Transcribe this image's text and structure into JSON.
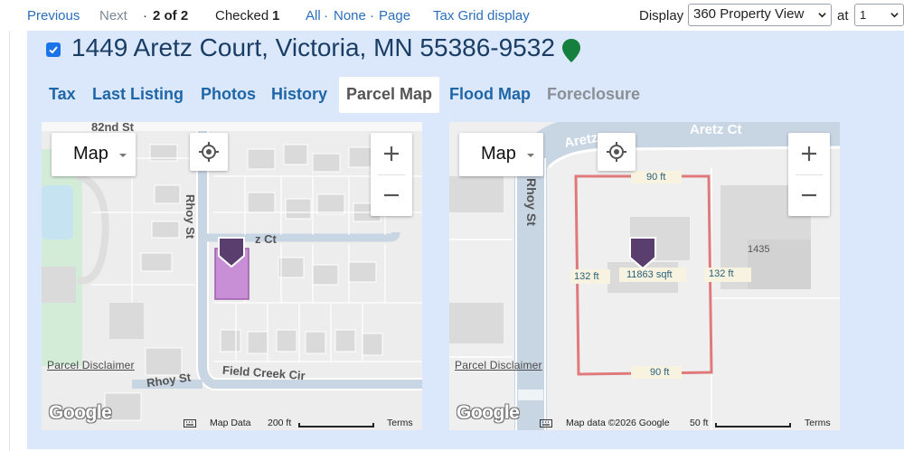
{
  "nav": {
    "previous": "Previous",
    "next": "Next",
    "dot": "·",
    "position": "2 of 2",
    "checked_label": "Checked",
    "checked_count": "1",
    "all": "All",
    "none": "None",
    "page": "Page",
    "sep": "·",
    "tax_grid": "Tax Grid display",
    "display_label": "Display",
    "display_value": "360 Property View",
    "at_label": "at",
    "at_value": "1"
  },
  "property": {
    "address": "1449 Aretz Court, Victoria, MN 55386-9532",
    "checked": true,
    "pin_color": "#15803d"
  },
  "tabs": [
    {
      "label": "Tax",
      "state": "normal"
    },
    {
      "label": "Last Listing",
      "state": "normal"
    },
    {
      "label": "Photos",
      "state": "normal"
    },
    {
      "label": "History",
      "state": "normal"
    },
    {
      "label": "Parcel Map",
      "state": "active"
    },
    {
      "label": "Flood Map",
      "state": "normal"
    },
    {
      "label": "Foreclosure",
      "state": "disabled"
    }
  ],
  "map_left": {
    "type_label": "Map",
    "zoom_in": "+",
    "zoom_out": "−",
    "disclaimer": "Parcel Disclaimer",
    "google": "Google",
    "map_data": "Map Data",
    "scale": "200 ft",
    "terms": "Terms",
    "streets": {
      "s82nd": "82nd St",
      "rhoy": "Rhoy St",
      "aretz_partial": "z Ct",
      "rhoy_st": "Rhoy St",
      "field_creek": "Field Creek Cir"
    },
    "parcel_color": "#c98fd6"
  },
  "map_right": {
    "type_label": "Map",
    "zoom_in": "+",
    "zoom_out": "−",
    "disclaimer": "Parcel Disclaimer",
    "google": "Google",
    "map_data": "Map data ©2026 Google",
    "scale": "50 ft",
    "terms": "Terms",
    "streets": {
      "aretz_partial": "Aretz",
      "aretz_ct": "Aretz Ct",
      "rhoy": "Rhoy St"
    },
    "dimensions": {
      "top": "90 ft",
      "bottom": "90 ft",
      "left": "132 ft",
      "right": "132 ft",
      "area": "11863 sqft"
    },
    "neighbor_number": "1435",
    "parcel_outline_color": "#e07a7a"
  },
  "colors": {
    "link": "#2a6ebb",
    "panel_bg": "#dbe8fb",
    "marker": "#5a3e6e"
  }
}
